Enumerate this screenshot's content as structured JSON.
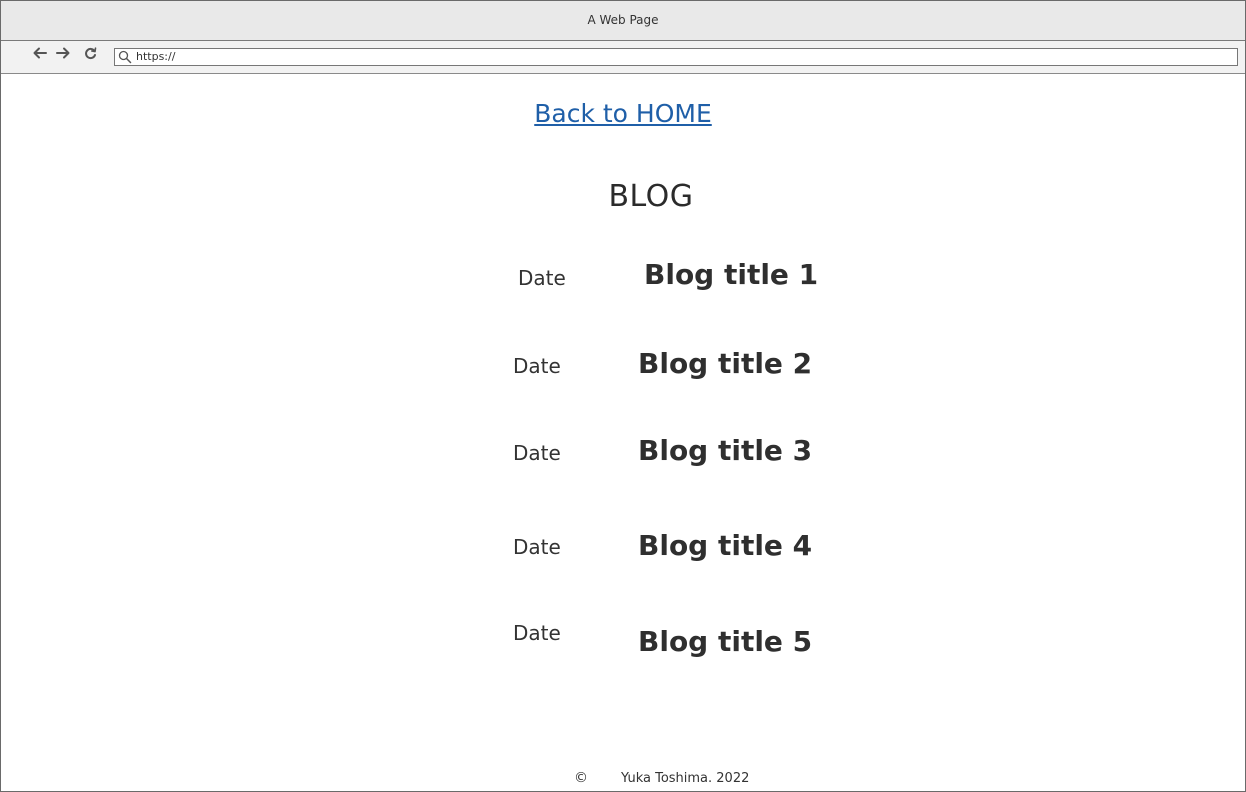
{
  "window": {
    "title": "A Web Page"
  },
  "toolbar": {
    "back_icon": "arrow-left-icon",
    "forward_icon": "arrow-right-icon",
    "reload_icon": "reload-icon",
    "url_icon": "search-icon",
    "url": "https://"
  },
  "page": {
    "back_link": "Back to HOME",
    "heading": "BLOG",
    "link_color": "#1f5fa8",
    "posts": [
      {
        "date": "Date",
        "title": "Blog title 1"
      },
      {
        "date": "Date",
        "title": "Blog title 2"
      },
      {
        "date": "Date",
        "title": "Blog title 3"
      },
      {
        "date": "Date",
        "title": "Blog title 4"
      },
      {
        "date": "Date",
        "title": "Blog title 5"
      }
    ]
  },
  "footer": {
    "copyright_symbol": "©",
    "text": "Yuka Toshima. 2022"
  }
}
